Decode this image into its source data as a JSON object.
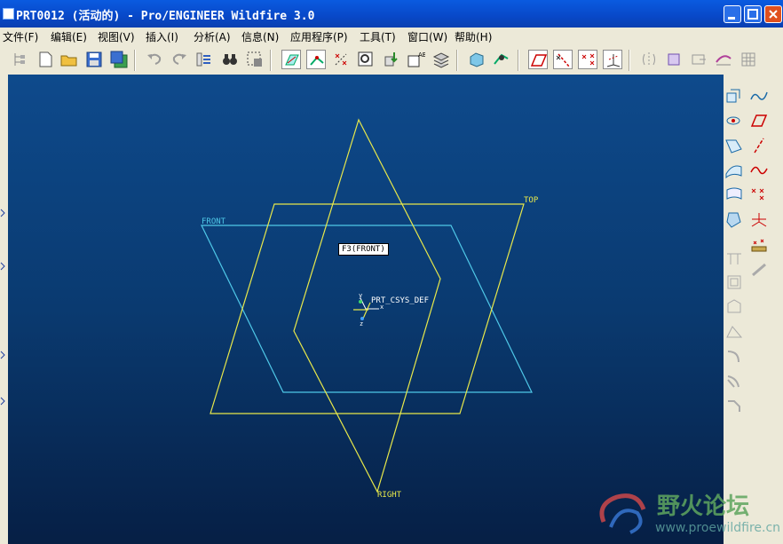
{
  "window": {
    "title": "PRT0012 (活动的) - Pro/ENGINEER Wildfire 3.0"
  },
  "menu": [
    {
      "label": "文件(F)"
    },
    {
      "label": "编辑(E)"
    },
    {
      "label": "视图(V)"
    },
    {
      "label": "插入(I)"
    },
    {
      "label": "分析(A)"
    },
    {
      "label": "信息(N)"
    },
    {
      "label": "应用程序(P)"
    },
    {
      "label": "工具(T)"
    },
    {
      "label": "窗口(W)"
    },
    {
      "label": "帮助(H)"
    }
  ],
  "viewport": {
    "tooltip": "F3(FRONT)",
    "planes": {
      "front": "FRONT",
      "top": "TOP",
      "right": "RIGHT"
    },
    "csys": {
      "label": "PRT_CSYS_DEF",
      "axis_x": "x",
      "axis_y": "y",
      "axis_z": "z"
    },
    "colors": {
      "front": "#4fc8e8",
      "top_right": "#e8e84a",
      "background": "#0a3a70"
    }
  },
  "watermark": {
    "text": "野火论坛",
    "url": "www.proewildfire.cn"
  }
}
